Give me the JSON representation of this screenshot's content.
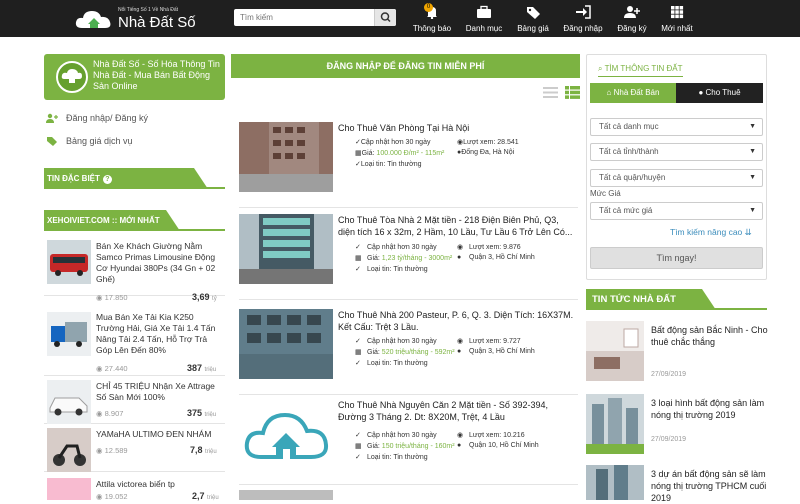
{
  "header": {
    "logo_tagline": "Nổi Tiếng Số 1 Về Nhà Đất",
    "logo_name": "Nhà Đất Số",
    "search_placeholder": "Tìm kiếm",
    "nav": [
      {
        "label": "Thông báo",
        "icon": "bell-icon",
        "badge": "0"
      },
      {
        "label": "Danh mục",
        "icon": "briefcase-icon"
      },
      {
        "label": "Bảng giá",
        "icon": "tag-icon"
      },
      {
        "label": "Đăng nhập",
        "icon": "login-icon"
      },
      {
        "label": "Đăng ký",
        "icon": "user-plus-icon"
      },
      {
        "label": "Mới nhất",
        "icon": "grid-icon"
      }
    ]
  },
  "left": {
    "promo": "Nhà Đất Số - Số Hóa Thông Tin Nhà Đất - Mua Bán Bất Động Sản Online",
    "login_link": "Đăng nhập/ Đăng ký",
    "price_link": "Bảng giá dịch vụ",
    "special_title": "TIN ĐẶC BIỆT",
    "xehoi_title": "XEHOIVIET.COM :: MỚI NHẤT",
    "cars": [
      {
        "title": "Bán Xe Khách Giường Nằm Samco Primas Limousine Động Cơ Hyundai 380Ps (34 Gn + 02 Ghế)",
        "views": "17.850",
        "price": "3,69",
        "unit": "tỷ"
      },
      {
        "title": "Mua Bán Xe Tải Kia K250 Trường Hải, Giá Xe Tải 1.4 Tấn Nâng Tải 2.4 Tấn, Hỗ Trợ Trả Góp Lên Đến 80%",
        "views": "27.440",
        "price": "387",
        "unit": "triệu"
      },
      {
        "title": "CHỈ 45 TRIỆU Nhận Xe Attrage Số Sàn Mới 100%",
        "views": "8.907",
        "price": "375",
        "unit": "triệu"
      },
      {
        "title": "YAMaHA ULTIMO ĐEN NHÁM",
        "views": "12.589",
        "price": "7,8",
        "unit": "triệu"
      },
      {
        "title": "Attila victorea biển tp",
        "views": "19.052",
        "price": "2,7",
        "unit": "triệu"
      }
    ]
  },
  "center": {
    "banner": "ĐĂNG NHẬP ĐỂ ĐĂNG TIN MIỄN PHÍ",
    "listings": [
      {
        "title": "Cho Thuê Văn Phòng Tại Hà Nội",
        "updated": "Cập nhật hơn 30 ngày",
        "views": "Lượt xem: 28.541",
        "price_label": "Giá: ",
        "price": "100.000 Đ/m² - 115m²",
        "location": "Đống Đa, Hà Nội",
        "type": "Loại tin: Tin thường"
      },
      {
        "title": "Cho Thuê Tòa Nhà 2 Mặt tiền - 218 Điện Biên Phủ, Q3, diện tích 16 x 32m, 2 Hầm, 10 Lầu, Tư Lầu 6 Trở Lên Có...",
        "updated": "Cập nhật hơn 30 ngày",
        "views": "Lượt xem: 9.876",
        "price_label": "Giá: ",
        "price": "1,23 tỷ/tháng - 3000m²",
        "location": "Quận 3, Hồ Chí Minh",
        "type": "Loại tin: Tin thường"
      },
      {
        "title": "Cho Thuê Nhà 200 Pasteur, P. 6, Q. 3. Diện Tích: 16X37M. Kết Cấu: Trệt 3 Lầu.",
        "updated": "Cập nhật hơn 30 ngày",
        "views": "Lượt xem: 9.727",
        "price_label": "Giá: ",
        "price": "520 triệu/tháng - 592m²",
        "location": "Quận 3, Hồ Chí Minh",
        "type": "Loại tin: Tin thường"
      },
      {
        "title": "Cho Thuê Nhà Nguyên Căn 2 Mặt tiền - Số 392-394, Đường 3 Tháng 2. Dt: 8X20M, Trệt, 4 Lầu",
        "updated": "Cập nhật hơn 30 ngày",
        "views": "Lượt xem: 10.216",
        "price_label": "Giá: ",
        "price": "150 triệu/tháng - 160m²",
        "location": "Quận 10, Hồ Chí Minh",
        "type": "Loại tin: Tin thường"
      }
    ]
  },
  "right": {
    "search_title": "TÌM THÔNG TIN ĐẤT",
    "tab_sale": "Nhà Đất Bán",
    "tab_rent": "Cho Thuê",
    "category": "Tất cả danh mục",
    "province": "Tất cả tỉnh/thành",
    "district": "Tất cả quận/huyện",
    "price_label": "Mức Giá",
    "price": "Tất cả mức giá",
    "advanced": "Tìm kiếm nâng cao",
    "search_btn": "Tìm ngay!",
    "news_title": "TIN TỨC NHÀ ĐẤT",
    "news": [
      {
        "title": "Bất động sản Bắc Ninh - Cho thuê chắc thắng",
        "date": "27/09/2019"
      },
      {
        "title": "3 loại hình bất động sản làm nóng thị trường 2019",
        "date": "27/09/2019"
      },
      {
        "title": "3 dự án bất động sản sẽ làm nóng thị trường TPHCM cuối 2019",
        "date": ""
      }
    ]
  },
  "colors": {
    "accent": "#7cb342",
    "header": "#1f1f1f",
    "link": "#3c8dbc"
  }
}
